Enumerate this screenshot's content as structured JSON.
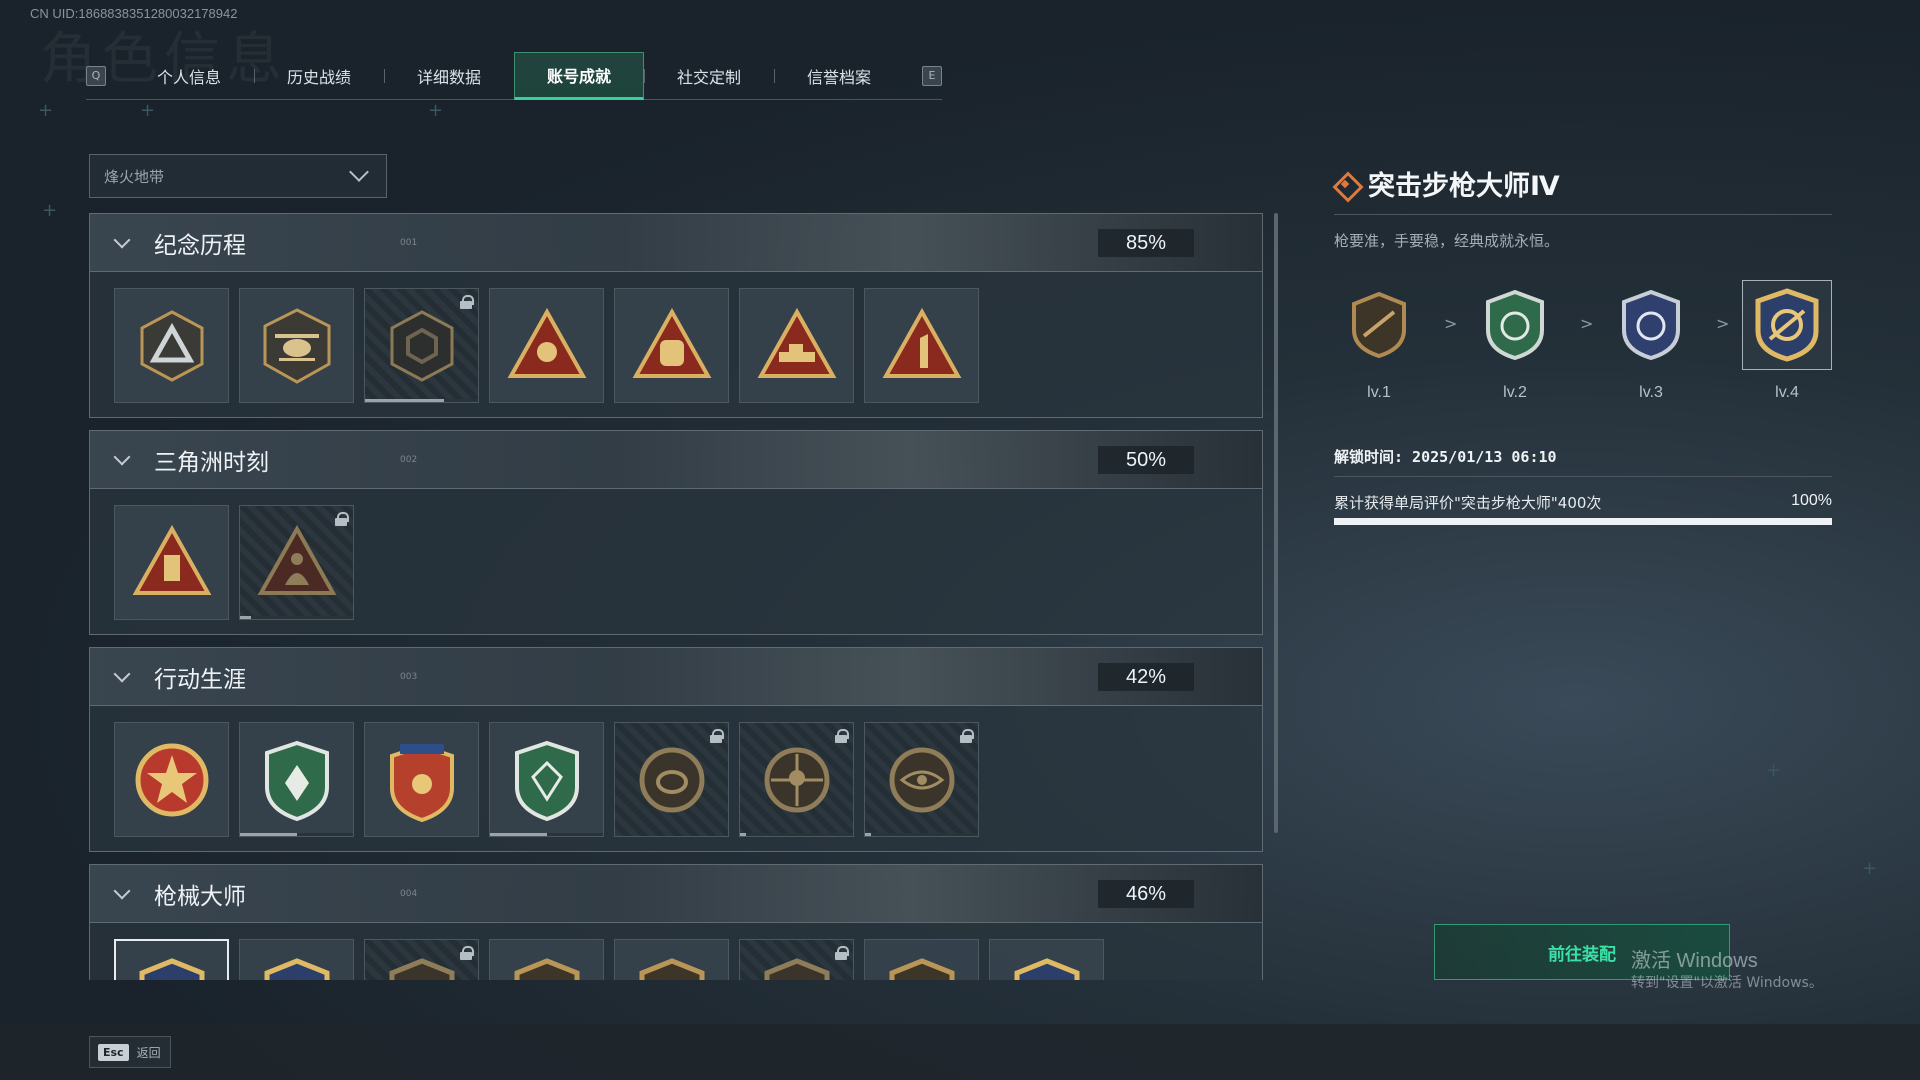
{
  "uid": "CN UID:1868838351280032178942",
  "bg_title": "角色信息",
  "tabs": {
    "left_key": "Q",
    "right_key": "E",
    "items": [
      "个人信息",
      "历史战绩",
      "详细数据",
      "账号成就",
      "社交定制",
      "信誉档案"
    ],
    "active": "账号成就"
  },
  "dropdown": {
    "value": "烽火地带"
  },
  "categories": [
    {
      "name": "纪念历程",
      "num": "001",
      "percent": "85%"
    },
    {
      "name": "三角洲时刻",
      "num": "002",
      "percent": "50%"
    },
    {
      "name": "行动生涯",
      "num": "003",
      "percent": "42%"
    },
    {
      "name": "枪械大师",
      "num": "004",
      "percent": "46%"
    }
  ],
  "detail": {
    "title": "突击步枪大师Ⅳ",
    "description": "枪要准，手要稳，经典成就永恒。",
    "levels": [
      "lv.1",
      "lv.2",
      "lv.3",
      "lv.4"
    ],
    "arrow": ">",
    "unlock_time": "解锁时间: 2025/01/13 06:10",
    "requirement": "累计获得单局评价\"突击步枪大师\"400次",
    "requirement_percent": "100%",
    "progress": 1.0,
    "equip_button": "前往装配"
  },
  "windows_watermark": {
    "line1": "激活 Windows",
    "line2": "转到\"设置\"以激活 Windows。"
  },
  "footer": {
    "esc_key": "Esc",
    "back_label": "返回"
  },
  "colors": {
    "accent": "#35d29b",
    "title_icon": "#e07a3c",
    "gold": "#c9a04a"
  }
}
